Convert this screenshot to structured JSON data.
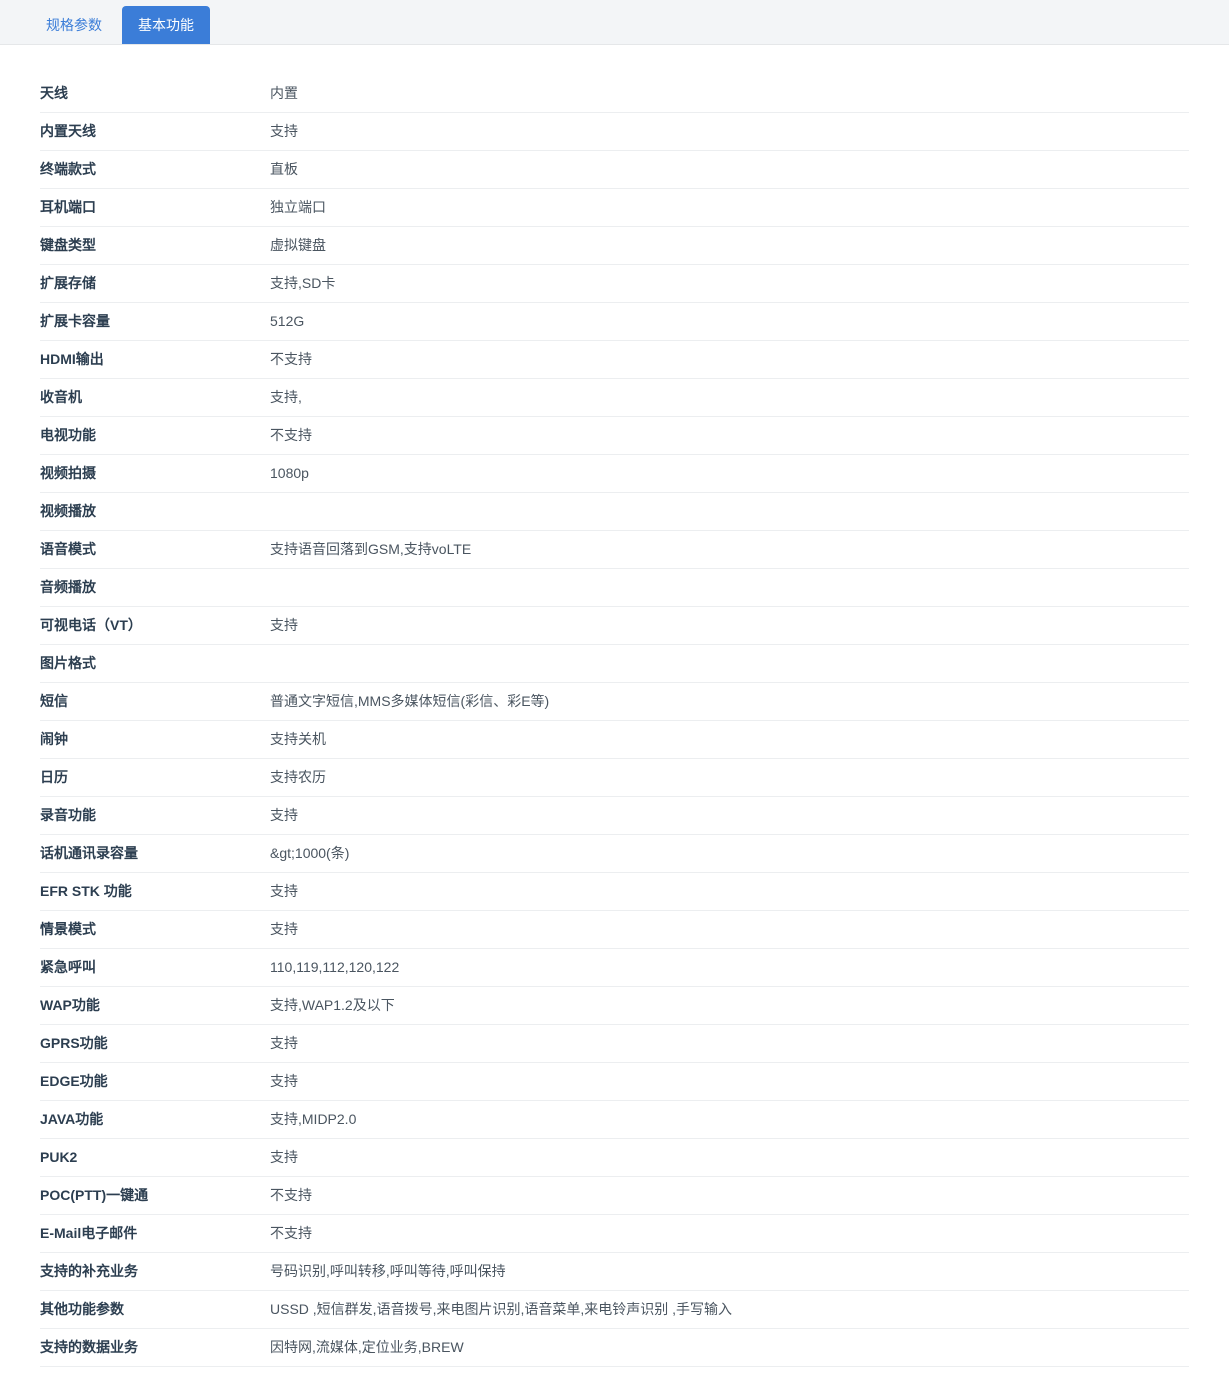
{
  "tabs": {
    "inactive": "规格参数",
    "active": "基本功能"
  },
  "rows": [
    {
      "label": "天线",
      "value": "内置"
    },
    {
      "label": "内置天线",
      "value": "支持"
    },
    {
      "label": "终端款式",
      "value": "直板"
    },
    {
      "label": "耳机端口",
      "value": "独立端口"
    },
    {
      "label": "键盘类型",
      "value": "虚拟键盘"
    },
    {
      "label": "扩展存储",
      "value": "支持,SD卡"
    },
    {
      "label": "扩展卡容量",
      "value": "512G"
    },
    {
      "label": "HDMI输出",
      "value": "不支持"
    },
    {
      "label": "收音机",
      "value": "支持,"
    },
    {
      "label": "电视功能",
      "value": "不支持"
    },
    {
      "label": "视频拍摄",
      "value": "1080p"
    },
    {
      "label": "视频播放",
      "value": ""
    },
    {
      "label": "语音模式",
      "value": "支持语音回落到GSM,支持voLTE"
    },
    {
      "label": "音频播放",
      "value": ""
    },
    {
      "label": "可视电话（VT）",
      "value": "支持"
    },
    {
      "label": "图片格式",
      "value": ""
    },
    {
      "label": "短信",
      "value": "普通文字短信,MMS多媒体短信(彩信、彩E等)"
    },
    {
      "label": "闹钟",
      "value": "支持关机"
    },
    {
      "label": "日历",
      "value": "支持农历"
    },
    {
      "label": "录音功能",
      "value": "支持"
    },
    {
      "label": "话机通讯录容量",
      "value": "&gt;1000(条)"
    },
    {
      "label": "EFR STK 功能",
      "value": "支持"
    },
    {
      "label": "情景模式",
      "value": "支持"
    },
    {
      "label": "紧急呼叫",
      "value": "110,119,112,120,122"
    },
    {
      "label": "WAP功能",
      "value": "支持,WAP1.2及以下"
    },
    {
      "label": "GPRS功能",
      "value": "支持"
    },
    {
      "label": "EDGE功能",
      "value": "支持"
    },
    {
      "label": "JAVA功能",
      "value": "支持,MIDP2.0"
    },
    {
      "label": "PUK2",
      "value": "支持"
    },
    {
      "label": "POC(PTT)一键通",
      "value": "不支持"
    },
    {
      "label": "E-Mail电子邮件",
      "value": "不支持"
    },
    {
      "label": "支持的补充业务",
      "value": "号码识别,呼叫转移,呼叫等待,呼叫保持"
    },
    {
      "label": "其他功能参数",
      "value": "USSD ,短信群发,语音拨号,来电图片识别,语音菜单,来电铃声识别 ,手写输入"
    },
    {
      "label": "支持的数据业务",
      "value": "因特网,流媒体,定位业务,BREW"
    }
  ]
}
